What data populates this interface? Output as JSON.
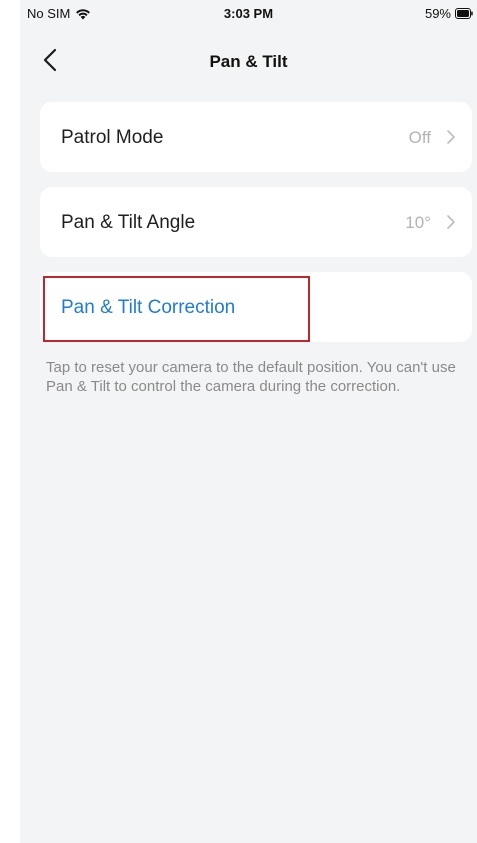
{
  "status_bar": {
    "carrier": "No SIM",
    "time": "3:03 PM",
    "battery": "59%",
    "icons": [
      "wifi-icon",
      "battery-icon"
    ]
  },
  "nav": {
    "title": "Pan & Tilt",
    "back_icon": "chevron-left-icon"
  },
  "settings": {
    "patrol_mode": {
      "label": "Patrol Mode",
      "value": "Off"
    },
    "pan_tilt_angle": {
      "label": "Pan & Tilt Angle",
      "value": "10°"
    },
    "pan_tilt_correction": {
      "label": "Pan & Tilt Correction"
    }
  },
  "hint": "Tap to reset your camera to the default position. You can't use Pan & Tilt to control the camera during the correction.",
  "colors": {
    "background": "#f3f4f6",
    "card": "#ffffff",
    "link": "#1f7bd8",
    "highlight": "#c0262e",
    "muted": "#8a8a8a"
  }
}
